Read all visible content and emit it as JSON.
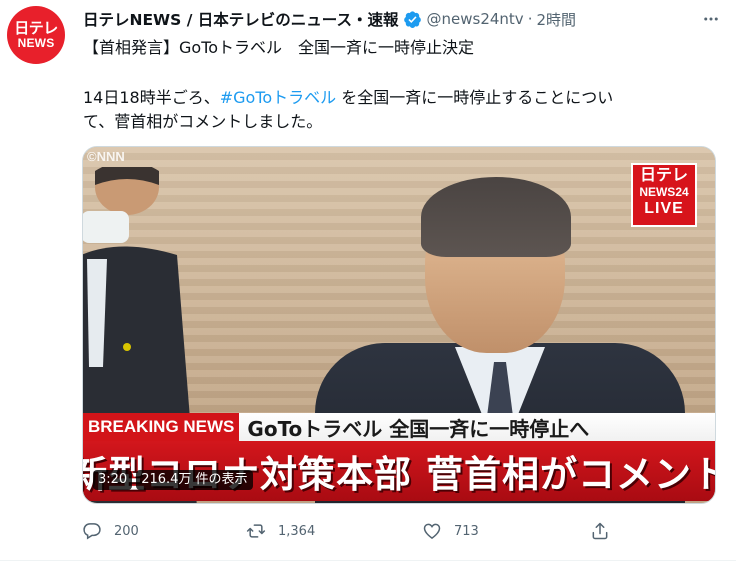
{
  "account": {
    "avatar_line1": "日テレ",
    "avatar_line2": "NEWS",
    "name": "日テレNEWS / 日本テレビのニュース・速報",
    "handle": "@news24ntv",
    "separator": "·",
    "time": "2時間"
  },
  "tweet": {
    "line1": "【首相発言】GoToトラベル　全国一斉に一時停止決定",
    "line2_before": "14日18時半ごろ、",
    "hashtag": "#GoToトラベル",
    "line2_after": " を全国一斉に一時停止することについ",
    "line3": "て、菅首相がコメントしました。"
  },
  "video": {
    "watermark": "©NNN",
    "logo_line1": "日テレ",
    "logo_line2": "NEWS24",
    "logo_line3": "LIVE",
    "breaking_label": "BREAKING NEWS",
    "headline_top": "GoToトラベル 全国一斉に一時停止へ",
    "headline_main": "新型コロナ対策本部 菅首相がコメント",
    "duration": "3:20",
    "views": "216.4万 件の表示"
  },
  "actions": {
    "reply_count": "200",
    "retweet_count": "1,364",
    "like_count": "713"
  },
  "colors": {
    "accent": "#1d9bf0",
    "muted": "#536471",
    "brand_red": "#d7141b"
  },
  "icons": [
    "verified-badge-icon",
    "more-icon",
    "reply-icon",
    "retweet-icon",
    "like-icon",
    "share-icon"
  ]
}
